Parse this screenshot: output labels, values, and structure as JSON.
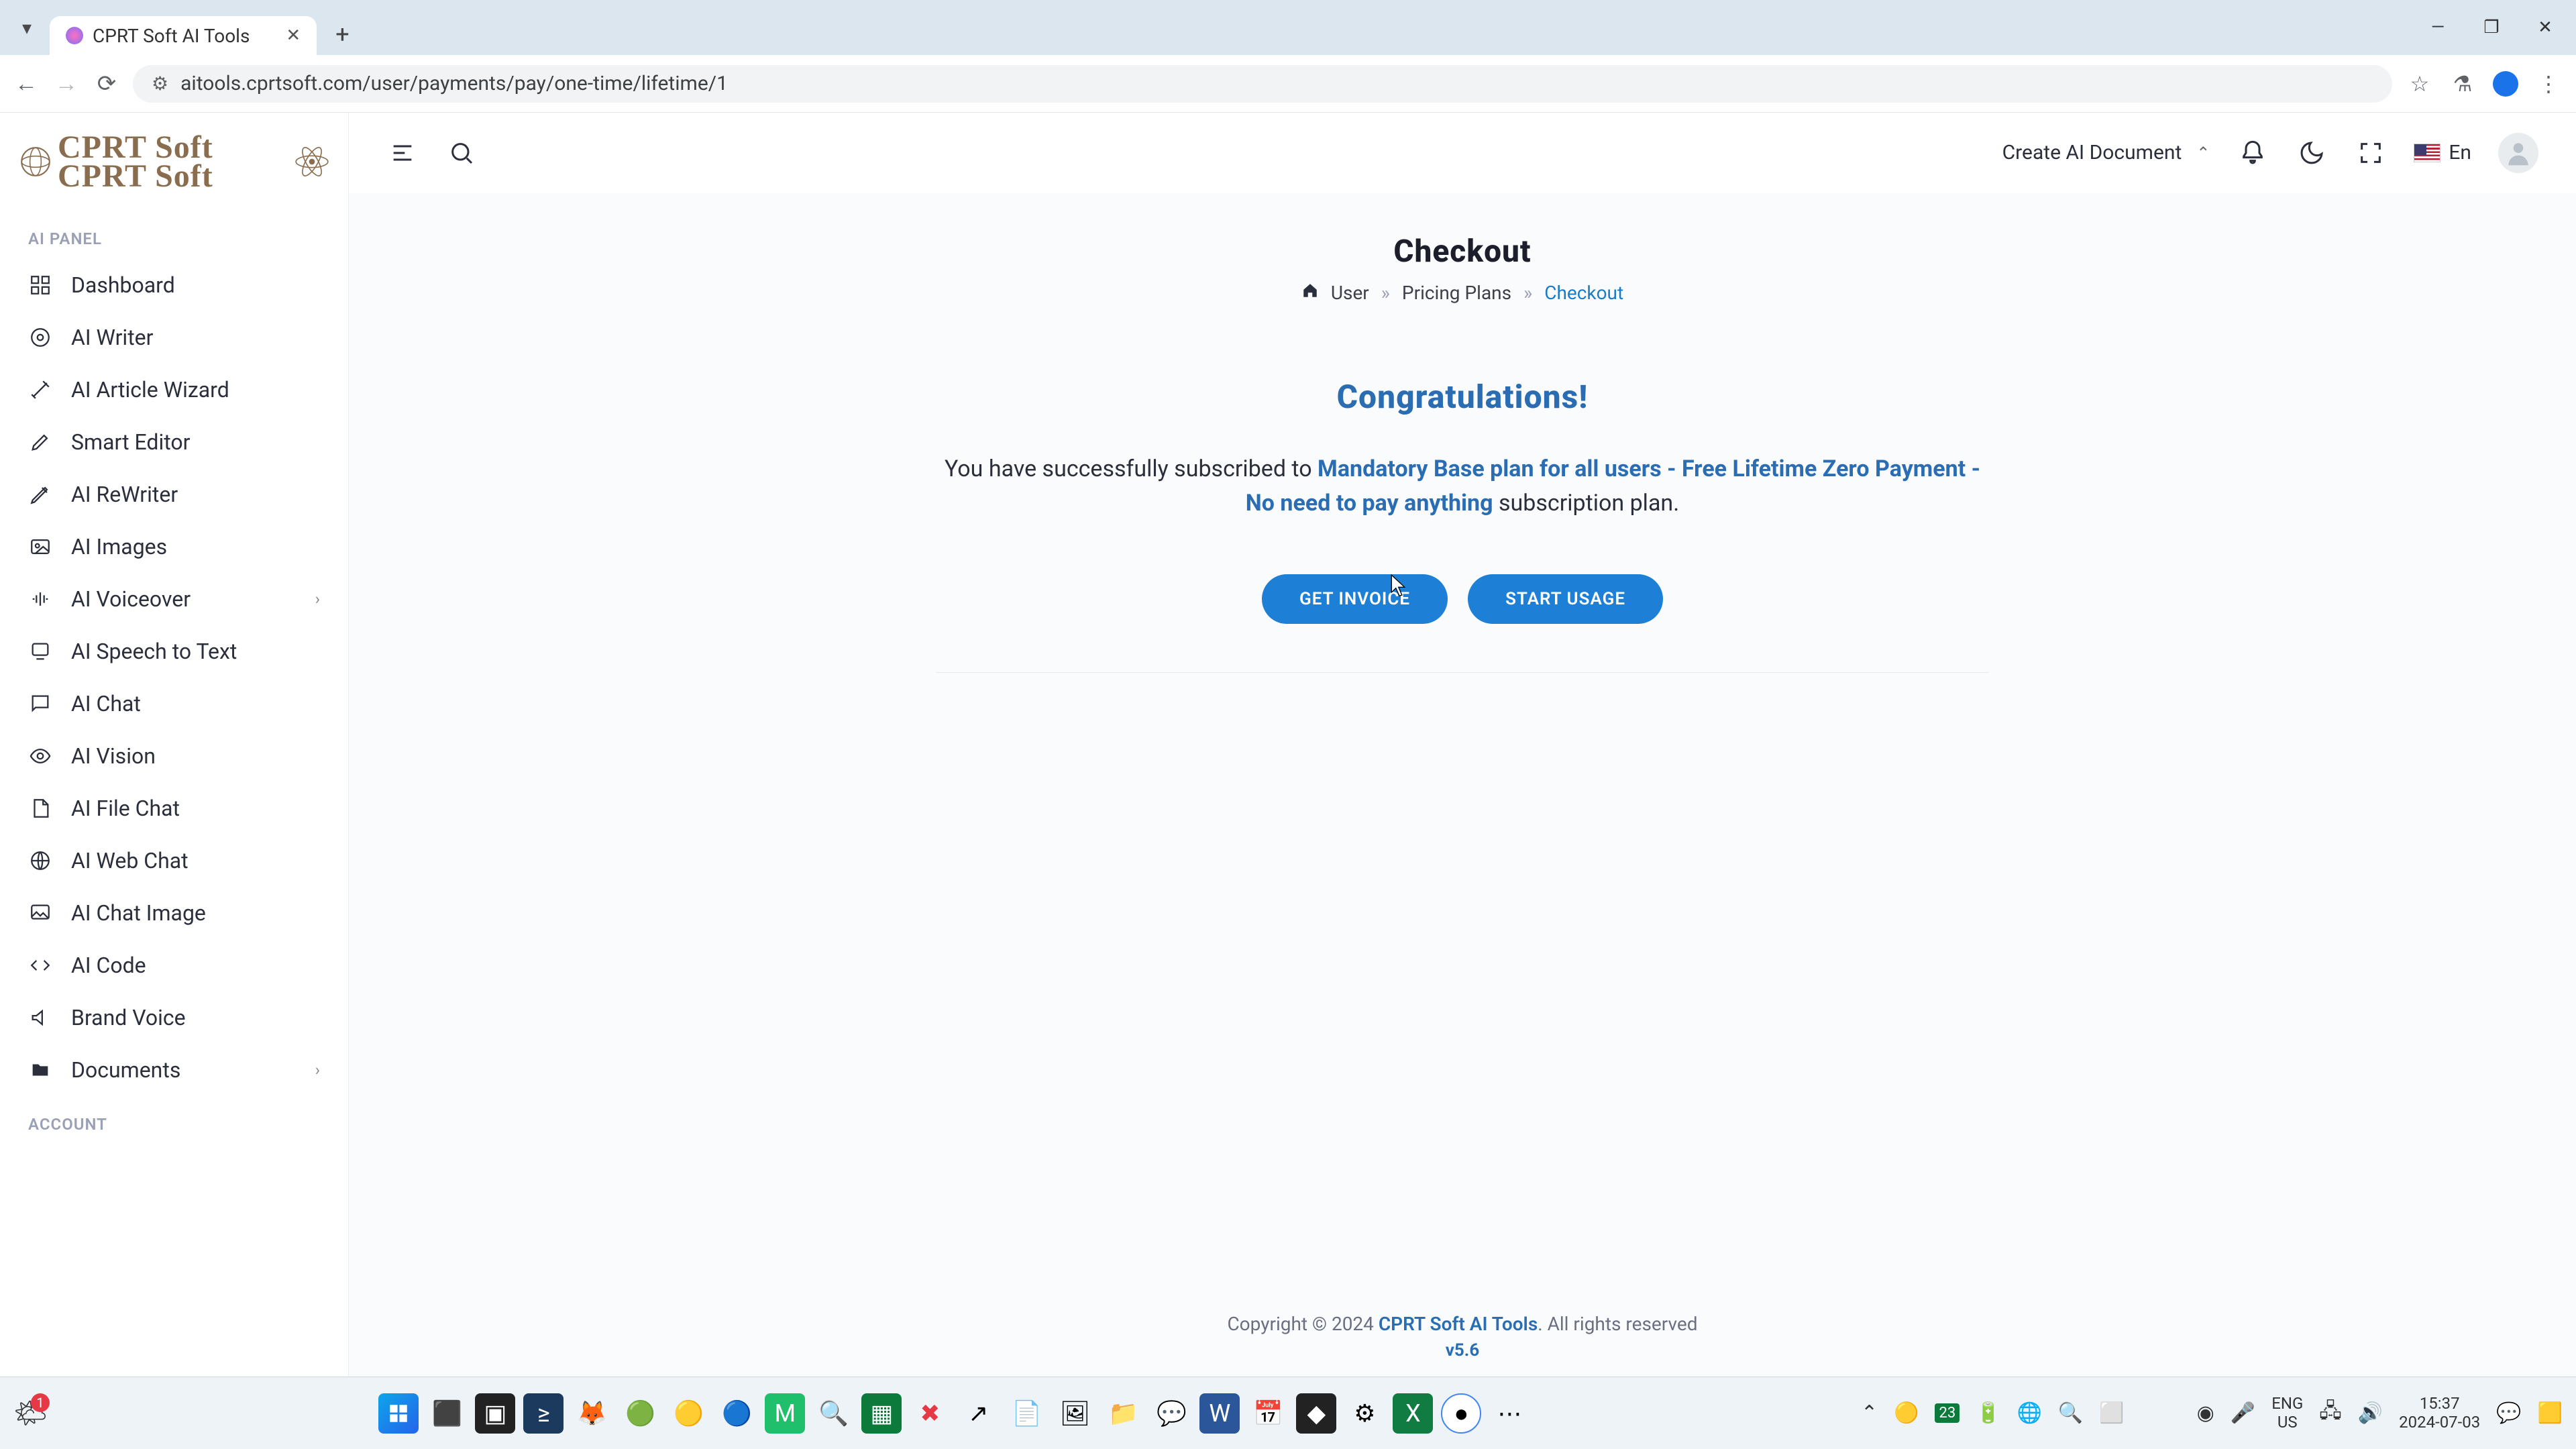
{
  "browser": {
    "tab_title": "CPRT Soft AI Tools",
    "url": "aitools.cprtsoft.com/user/payments/pay/one-time/lifetime/1"
  },
  "logo_text": "CPRT Soft",
  "topbar": {
    "create_label": "Create AI Document",
    "lang_label": "En"
  },
  "sidebar": {
    "section1": "AI PANEL",
    "section2": "ACCOUNT",
    "items": [
      {
        "label": "Dashboard"
      },
      {
        "label": "AI Writer"
      },
      {
        "label": "AI Article Wizard"
      },
      {
        "label": "Smart Editor"
      },
      {
        "label": "AI ReWriter"
      },
      {
        "label": "AI Images"
      },
      {
        "label": "AI Voiceover",
        "expandable": true
      },
      {
        "label": "AI Speech to Text"
      },
      {
        "label": "AI Chat"
      },
      {
        "label": "AI Vision"
      },
      {
        "label": "AI File Chat"
      },
      {
        "label": "AI Web Chat"
      },
      {
        "label": "AI Chat Image"
      },
      {
        "label": "AI Code"
      },
      {
        "label": "Brand Voice"
      },
      {
        "label": "Documents",
        "expandable": true
      }
    ]
  },
  "page": {
    "title": "Checkout",
    "breadcrumb": {
      "home": "User",
      "mid": "Pricing Plans",
      "current": "Checkout",
      "sep": "»"
    },
    "congrats": "Congratulations!",
    "msg_pre": "You have successfully subscribed to ",
    "plan_line1": "Mandatory Base plan for all users - Free Lifetime Zero Payment -",
    "plan_line2": "No need to pay anything",
    "msg_post": " subscription plan.",
    "btn_invoice": "GET INVOICE",
    "btn_start": "START USAGE"
  },
  "footer": {
    "copyright_pre": "Copyright © 2024 ",
    "brand": "CPRT Soft AI Tools",
    "copyright_post": ". All rights reserved",
    "version": "v5.6"
  },
  "taskbar": {
    "weather_badge": "1",
    "lang1": "ENG",
    "lang2": "US",
    "time": "15:37",
    "date": "2024-07-03"
  }
}
